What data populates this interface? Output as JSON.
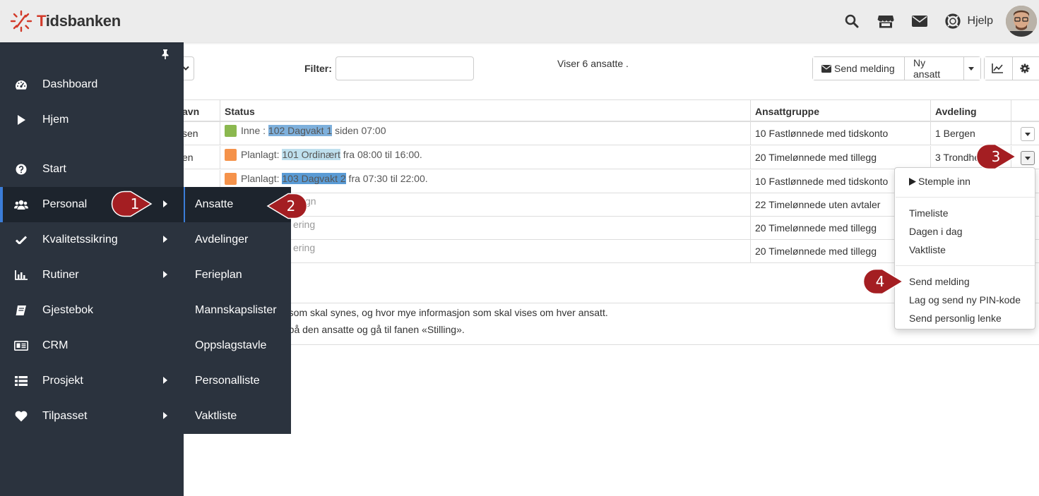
{
  "header": {
    "logo_prefix": "T",
    "logo_rest": "idsbanken",
    "help_label": "Hjelp",
    "icons": [
      "search-icon",
      "store-icon",
      "envelope-icon",
      "lifebuoy-icon"
    ]
  },
  "toolbar": {
    "filter_label": "Filter:",
    "filter_value": "",
    "count_text": "Viser 6 ansatte .",
    "send_message_label": "Send melding",
    "new_employee_label": "Ny ansatt"
  },
  "table": {
    "headers": [
      "avn",
      "Status",
      "Ansattgruppe",
      "Avdeling"
    ],
    "rows": [
      {
        "name": "sen",
        "status_prefix": "Inne : ",
        "shift": "102 Dagvakt 1",
        "status_suffix": " siden 07:00",
        "status_color": "#8bb84f",
        "group": "10 Fastlønnede med tidskonto",
        "dept": "1 Bergen"
      },
      {
        "name": "en",
        "status_prefix": "Planlagt: ",
        "shift": "101 Ordinært",
        "status_suffix": " fra 08:00 til 16:00.",
        "status_color": "#f5924a",
        "group": "20 Timelønnede med tillegg",
        "dept": "3 Trondhei"
      },
      {
        "name": "",
        "status_prefix": "Planlagt: ",
        "shift": "103 Dagvakt 2",
        "status_suffix": " fra 07:30 til 22:00.",
        "status_color": "#f5924a",
        "group": "10 Fastlønnede med tidskonto",
        "dept": ""
      },
      {
        "name": "",
        "status_partial": "gn",
        "group": "22 Timelønnede uten avtaler",
        "dept": ""
      },
      {
        "name": "",
        "status_partial": "ering",
        "group": "20 Timelønnede med tillegg",
        "dept": ""
      },
      {
        "name": "",
        "status_partial": "ering",
        "group": "20 Timelønnede med tillegg",
        "dept": ""
      }
    ]
  },
  "info": {
    "line1": "e som skal synes, og hvor mye informasjon som skal vises om hver ansatt.",
    "line2": "n på den ansatte og gå til fanen «Stilling»."
  },
  "sidebar": {
    "items": [
      {
        "label": "Dashboard",
        "icon": "dashboard-icon"
      },
      {
        "label": "Hjem",
        "icon": "play-icon"
      },
      {
        "label": "Start",
        "icon": "question-icon"
      },
      {
        "label": "Personal",
        "icon": "users-icon"
      },
      {
        "label": "Kvalitetssikring",
        "icon": "check-icon"
      },
      {
        "label": "Rutiner",
        "icon": "bar-chart-icon"
      },
      {
        "label": "Gjestebok",
        "icon": "book-icon"
      },
      {
        "label": "CRM",
        "icon": "id-card-icon"
      },
      {
        "label": "Prosjekt",
        "icon": "list-icon"
      },
      {
        "label": "Tilpasset",
        "icon": "heart-icon"
      }
    ]
  },
  "submenu": {
    "items": [
      "Ansatte",
      "Avdelinger",
      "Ferieplan",
      "Mannskapslister",
      "Oppslagstavle",
      "Personalliste",
      "Vaktliste"
    ]
  },
  "row_menu": {
    "punch_in": "Stemple inn",
    "timesheet": "Timeliste",
    "today": "Dagen i dag",
    "shift_list": "Vaktliste",
    "send_message": "Send melding",
    "pin_code": "Lag og send ny PIN-kode",
    "personal_link": "Send personlig lenke"
  },
  "callouts": [
    "1",
    "2",
    "3",
    "4"
  ],
  "colors": {
    "sidebar_bg": "#2b333e",
    "sidebar_active_bg": "#1d242d",
    "accent_blue": "#3b7dd8",
    "callout_red": "#a41e22",
    "status_green": "#8bb84f",
    "status_orange": "#f5924a"
  }
}
